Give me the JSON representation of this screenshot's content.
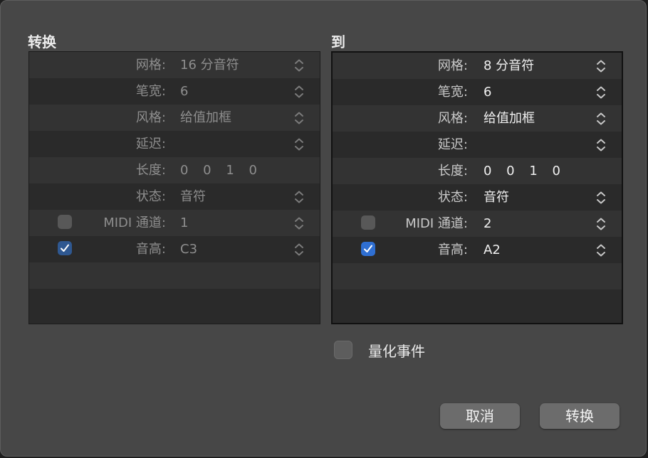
{
  "dialog": {
    "from_title": "转换",
    "to_title": "到",
    "from_rows": [
      {
        "label": "网格:",
        "value": "16 分音符",
        "stepper": true,
        "checkbox": null
      },
      {
        "label": "笔宽:",
        "value": "6",
        "stepper": true,
        "checkbox": null
      },
      {
        "label": "风格:",
        "value": "给值加框",
        "stepper": true,
        "checkbox": null
      },
      {
        "label": "延迟:",
        "value": "",
        "stepper": true,
        "checkbox": null
      },
      {
        "label": "长度:",
        "value": "0 0 1   0",
        "stepper": false,
        "checkbox": null
      },
      {
        "label": "状态:",
        "value": "音符",
        "stepper": true,
        "checkbox": null
      },
      {
        "label": "MIDI 通道:",
        "value": "1",
        "stepper": true,
        "checkbox": false
      },
      {
        "label": "音高:",
        "value": "C3",
        "stepper": true,
        "checkbox": true
      }
    ],
    "to_rows": [
      {
        "label": "网格:",
        "value": "8 分音符",
        "stepper": true,
        "checkbox": null
      },
      {
        "label": "笔宽:",
        "value": "6",
        "stepper": true,
        "checkbox": null
      },
      {
        "label": "风格:",
        "value": "给值加框",
        "stepper": true,
        "checkbox": null
      },
      {
        "label": "延迟:",
        "value": "",
        "stepper": true,
        "checkbox": null
      },
      {
        "label": "长度:",
        "value": "0 0 1   0",
        "stepper": false,
        "checkbox": null
      },
      {
        "label": "状态:",
        "value": "音符",
        "stepper": true,
        "checkbox": null
      },
      {
        "label": "MIDI 通道:",
        "value": "2",
        "stepper": true,
        "checkbox": false
      },
      {
        "label": "音高:",
        "value": "A2",
        "stepper": true,
        "checkbox": true
      }
    ],
    "quantize_label": "量化事件",
    "quantize_checked": false,
    "cancel_label": "取消",
    "convert_label": "转换"
  },
  "icons": {
    "stepper": "up-down-chevron-icon",
    "checkmark": "checkmark-icon"
  },
  "colors": {
    "dialog_bg": "#474747",
    "panel_bg": "#333333",
    "checkbox_on_active": "#2f6fd2",
    "checkbox_on_inactive": "#2f5891"
  }
}
